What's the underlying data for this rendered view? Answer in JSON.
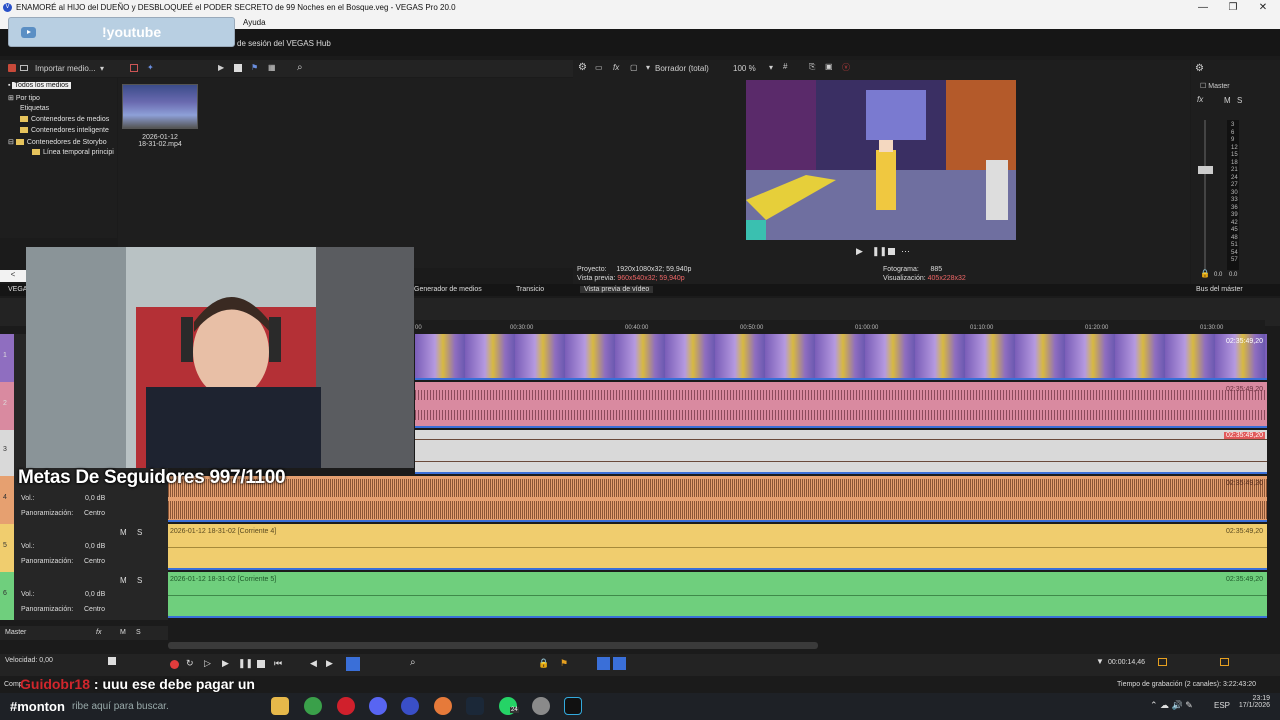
{
  "window": {
    "title": "ENAMORÉ al HIJO del DUEÑO y DESBLOQUEÉ el PODER SECRETO de 99 Noches en el Bosque.veg - VEGAS Pro 20.0",
    "minimize": "—",
    "restore": "❐",
    "close": "✕"
  },
  "menubar": {
    "items": [
      "Ayuda"
    ]
  },
  "hub": {
    "link": "de sesión del VEGAS Hub"
  },
  "overlay_youtube": {
    "label": "!youtube"
  },
  "media_toolbar": {
    "import_label": "Importar medio..."
  },
  "media_tree": {
    "items": [
      "Todos los medios",
      "Por tipo",
      "Etiquetas",
      "Contenedores de medios",
      "Contenedores inteligente",
      "Contenedores de Storybo",
      "Línea temporal principi"
    ]
  },
  "media_item": {
    "name_line1": "2026-01-12",
    "name_line2": "18-31-02.mp4"
  },
  "preview_toolbar": {
    "mode": "Borrador (total)",
    "zoom": "100 %"
  },
  "preview_info": {
    "project_label": "Proyecto:",
    "project_value": "1920x1080x32; 59,940p",
    "preview_label": "Vista previa:",
    "preview_value": "960x540x32; 59,940p",
    "frame_label": "Fotograma:",
    "frame_value": "885",
    "display_label": "Visualización:",
    "display_value": "405x228x32"
  },
  "master_bus": {
    "title": "Master",
    "m": "M",
    "s": "S",
    "meter_ticks": [
      "3",
      "6",
      "9",
      "12",
      "15",
      "18",
      "21",
      "24",
      "27",
      "30",
      "33",
      "36",
      "39",
      "42",
      "45",
      "48",
      "51",
      "54",
      "57"
    ],
    "left_val": "0.0",
    "right_val": "0.0"
  },
  "tabs": {
    "vegas": "VEGA",
    "media_gen": "Generador de medios",
    "transitions": "Transicio",
    "video_preview": "Vista previa de vídeo",
    "master_bus": "Bus del máster"
  },
  "ruler": {
    "ticks": [
      "00",
      "00:30:00",
      "00:40:00",
      "00:50:00",
      "01:00:00",
      "01:10:00",
      "01:20:00",
      "01:30:00"
    ]
  },
  "tracks": [
    {
      "num": "1",
      "end": "02:35:49,20"
    },
    {
      "num": "2",
      "end": "02:35:49,20"
    },
    {
      "num": "3",
      "end": "02:35:49,20"
    },
    {
      "num": "4",
      "end": "02:35:49,20",
      "vol_label": "Vol.:",
      "vol_value": "0,0 dB",
      "pan_label": "Panoramización:",
      "pan_value": "Centro"
    },
    {
      "num": "5",
      "clip": "2026-01-12 18-31-02 [Corriente 4]",
      "end": "02:35:49,20",
      "vol_label": "Vol.:",
      "vol_value": "0,0 dB",
      "pan_label": "Panoramización:",
      "pan_value": "Centro",
      "m": "M",
      "s": "S"
    },
    {
      "num": "6",
      "clip": "2026-01-12 18-31-02 [Corriente 5]",
      "end": "02:35:49,20",
      "vol_label": "Vol.:",
      "vol_value": "0,0 dB",
      "pan_label": "Panoramización:",
      "pan_value": "Centro",
      "m": "M",
      "s": "S"
    }
  ],
  "master_row": {
    "label": "Master",
    "m": "M",
    "s": "S"
  },
  "transport": {
    "speed": "Velocidad: 0,00",
    "time": "00:00:14,46",
    "rec_time": "Tiempo de grabación (2 canales): 3:22:43:20"
  },
  "overlay_goal": {
    "text": "Metas De Seguidores  997/1100"
  },
  "overlay_chat": {
    "user": "Guidobr18",
    "message": " : uuu ese debe pagar un"
  },
  "taskbar": {
    "search_user": "#monton",
    "search_placeholder": "ribe aquí para buscar.",
    "complete_stub": "Comp",
    "lang": "ESP",
    "time": "23:19",
    "date": "17/1/2026",
    "badge": "24"
  },
  "colors": {
    "track_video": "#8f6ec0",
    "track_audio2": "#d98aa0",
    "track_audio3": "#d9d9d9",
    "track_audio4": "#e6a070",
    "track_audio5": "#f0cd6e",
    "track_audio6": "#6fcf7d"
  }
}
